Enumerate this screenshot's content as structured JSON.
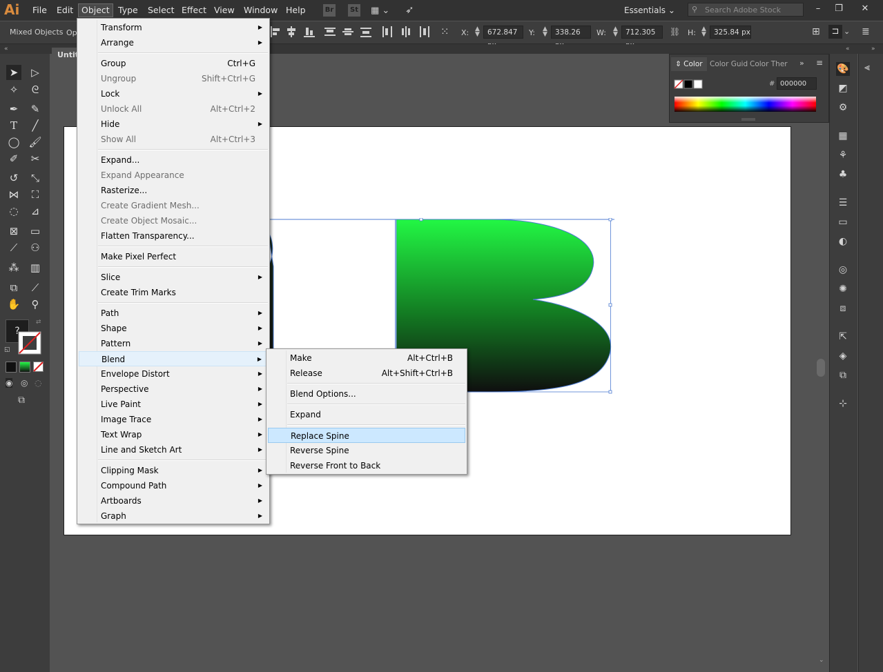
{
  "app": {
    "logo": "Ai"
  },
  "menubar": {
    "items": [
      "File",
      "Edit",
      "Object",
      "Type",
      "Select",
      "Effect",
      "View",
      "Window",
      "Help"
    ],
    "active": "Object",
    "bridge_icon": "Br",
    "stock_icon": "St",
    "workspace": "Essentials",
    "search_placeholder": "Search Adobe Stock"
  },
  "controlbar": {
    "selection_label": "Mixed Objects",
    "opacity_label": "Opa",
    "x_label": "X:",
    "x_value": "672.847 px",
    "y_label": "Y:",
    "y_value": "338.26 px",
    "w_label": "W:",
    "w_value": "712.305 px",
    "h_label": "H:",
    "h_value": "325.84 px"
  },
  "document": {
    "tab_title": "Untitled"
  },
  "toolbar": {
    "unknown_label": "?"
  },
  "color_panel": {
    "tabs": [
      "Color",
      "Color Guid",
      "Color Ther"
    ],
    "hex_label": "#",
    "hex_value": "000000"
  },
  "object_menu": {
    "items": [
      {
        "label": "Transform",
        "shortcut": "",
        "submenu": true,
        "disabled": false
      },
      {
        "label": "Arrange",
        "shortcut": "",
        "submenu": true,
        "disabled": false
      },
      {
        "sep": true
      },
      {
        "label": "Group",
        "shortcut": "Ctrl+G",
        "submenu": false,
        "disabled": false
      },
      {
        "label": "Ungroup",
        "shortcut": "Shift+Ctrl+G",
        "submenu": false,
        "disabled": true
      },
      {
        "label": "Lock",
        "shortcut": "",
        "submenu": true,
        "disabled": false
      },
      {
        "label": "Unlock All",
        "shortcut": "Alt+Ctrl+2",
        "submenu": false,
        "disabled": true
      },
      {
        "label": "Hide",
        "shortcut": "",
        "submenu": true,
        "disabled": false
      },
      {
        "label": "Show All",
        "shortcut": "Alt+Ctrl+3",
        "submenu": false,
        "disabled": true
      },
      {
        "sep": true
      },
      {
        "label": "Expand...",
        "shortcut": "",
        "submenu": false,
        "disabled": false
      },
      {
        "label": "Expand Appearance",
        "shortcut": "",
        "submenu": false,
        "disabled": true
      },
      {
        "label": "Rasterize...",
        "shortcut": "",
        "submenu": false,
        "disabled": false
      },
      {
        "label": "Create Gradient Mesh...",
        "shortcut": "",
        "submenu": false,
        "disabled": true
      },
      {
        "label": "Create Object Mosaic...",
        "shortcut": "",
        "submenu": false,
        "disabled": true
      },
      {
        "label": "Flatten Transparency...",
        "shortcut": "",
        "submenu": false,
        "disabled": false
      },
      {
        "sep": true
      },
      {
        "label": "Make Pixel Perfect",
        "shortcut": "",
        "submenu": false,
        "disabled": false
      },
      {
        "sep": true
      },
      {
        "label": "Slice",
        "shortcut": "",
        "submenu": true,
        "disabled": false
      },
      {
        "label": "Create Trim Marks",
        "shortcut": "",
        "submenu": false,
        "disabled": false
      },
      {
        "sep": true
      },
      {
        "label": "Path",
        "shortcut": "",
        "submenu": true,
        "disabled": false
      },
      {
        "label": "Shape",
        "shortcut": "",
        "submenu": true,
        "disabled": false
      },
      {
        "label": "Pattern",
        "shortcut": "",
        "submenu": true,
        "disabled": false
      },
      {
        "label": "Blend",
        "shortcut": "",
        "submenu": true,
        "disabled": false,
        "open": true
      },
      {
        "label": "Envelope Distort",
        "shortcut": "",
        "submenu": true,
        "disabled": false
      },
      {
        "label": "Perspective",
        "shortcut": "",
        "submenu": true,
        "disabled": false
      },
      {
        "label": "Live Paint",
        "shortcut": "",
        "submenu": true,
        "disabled": false
      },
      {
        "label": "Image Trace",
        "shortcut": "",
        "submenu": true,
        "disabled": false
      },
      {
        "label": "Text Wrap",
        "shortcut": "",
        "submenu": true,
        "disabled": false
      },
      {
        "label": "Line and Sketch Art",
        "shortcut": "",
        "submenu": true,
        "disabled": false
      },
      {
        "sep": true
      },
      {
        "label": "Clipping Mask",
        "shortcut": "",
        "submenu": true,
        "disabled": false
      },
      {
        "label": "Compound Path",
        "shortcut": "",
        "submenu": true,
        "disabled": false
      },
      {
        "label": "Artboards",
        "shortcut": "",
        "submenu": true,
        "disabled": false
      },
      {
        "label": "Graph",
        "shortcut": "",
        "submenu": true,
        "disabled": false
      }
    ]
  },
  "blend_menu": {
    "items": [
      {
        "label": "Make",
        "shortcut": "Alt+Ctrl+B"
      },
      {
        "label": "Release",
        "shortcut": "Alt+Shift+Ctrl+B"
      },
      {
        "sep": true
      },
      {
        "label": "Blend Options...",
        "shortcut": ""
      },
      {
        "sep": true
      },
      {
        "label": "Expand",
        "shortcut": ""
      },
      {
        "sep": true
      },
      {
        "label": "Replace Spine",
        "shortcut": "",
        "hover": true
      },
      {
        "label": "Reverse Spine",
        "shortcut": ""
      },
      {
        "label": "Reverse Front to Back",
        "shortcut": ""
      }
    ]
  },
  "colors": {
    "accent": "#0078d7",
    "gradient_top": "#22f744",
    "gradient_bottom": "#0f0f0f",
    "selection": "#4d7bd1"
  }
}
